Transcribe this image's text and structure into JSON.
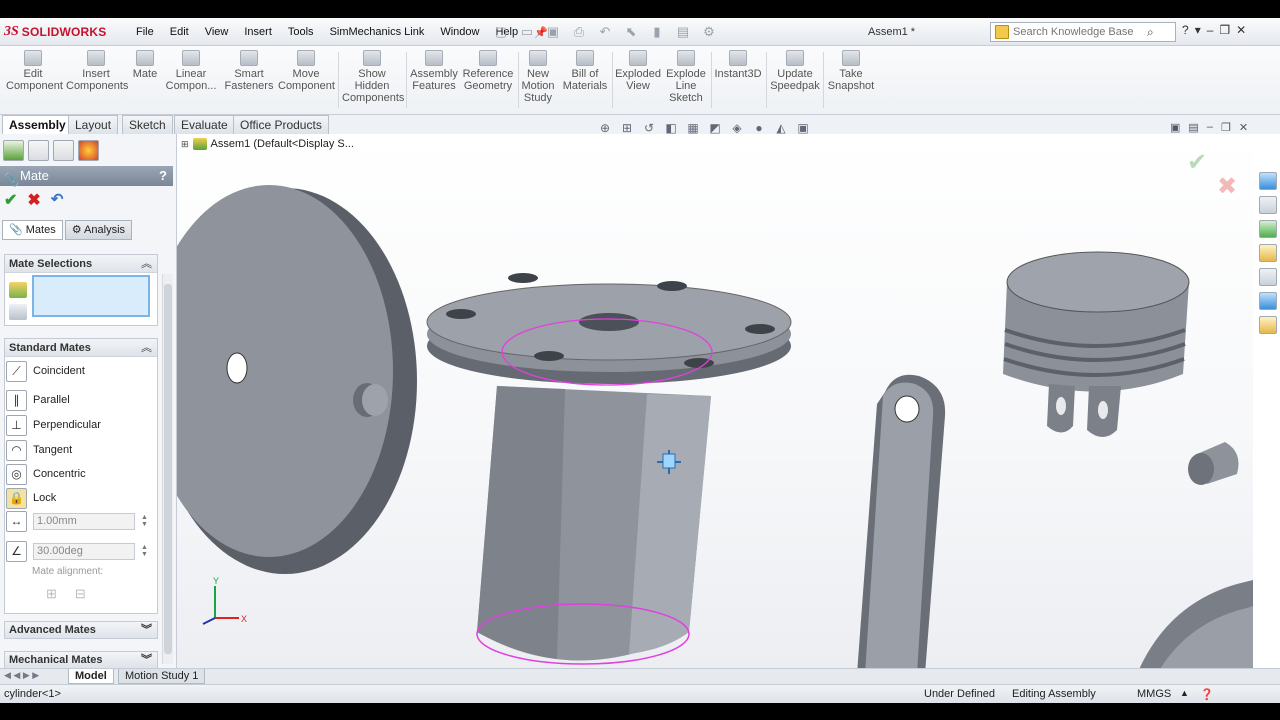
{
  "app": {
    "logo_ds": "3S",
    "logo_text": "SOLIDWORKS",
    "document_title": "Assem1 *"
  },
  "menu": [
    "File",
    "Edit",
    "View",
    "Insert",
    "Tools",
    "SimMechanics Link",
    "Window",
    "Help"
  ],
  "search": {
    "placeholder": "Search Knowledge Base"
  },
  "command_manager": [
    {
      "label_1": "Edit",
      "label_2": "Component",
      "label_3": ""
    },
    {
      "label_1": "Insert",
      "label_2": "Components",
      "label_3": ""
    },
    {
      "label_1": "Mate",
      "label_2": "",
      "label_3": ""
    },
    {
      "label_1": "Linear",
      "label_2": "Compon...",
      "label_3": ""
    },
    {
      "label_1": "Smart",
      "label_2": "Fasteners",
      "label_3": ""
    },
    {
      "label_1": "Move",
      "label_2": "Component",
      "label_3": ""
    },
    {
      "label_1": "Show",
      "label_2": "Hidden",
      "label_3": "Components"
    },
    {
      "label_1": "Assembly",
      "label_2": "Features",
      "label_3": ""
    },
    {
      "label_1": "Reference",
      "label_2": "Geometry",
      "label_3": ""
    },
    {
      "label_1": "New",
      "label_2": "Motion",
      "label_3": "Study"
    },
    {
      "label_1": "Bill of",
      "label_2": "Materials",
      "label_3": ""
    },
    {
      "label_1": "Exploded",
      "label_2": "View",
      "label_3": ""
    },
    {
      "label_1": "Explode",
      "label_2": "Line",
      "label_3": "Sketch"
    },
    {
      "label_1": "Instant3D",
      "label_2": "",
      "label_3": ""
    },
    {
      "label_1": "Update",
      "label_2": "Speedpak",
      "label_3": ""
    },
    {
      "label_1": "Take",
      "label_2": "Snapshot",
      "label_3": ""
    }
  ],
  "tabs": [
    "Assembly",
    "Layout",
    "Sketch",
    "Evaluate",
    "Office Products"
  ],
  "property_manager": {
    "title": "Mate",
    "help": "?",
    "sub_tabs": [
      "Mates",
      "Analysis"
    ],
    "mate_selections_title": "Mate Selections",
    "standard_mates_title": "Standard Mates",
    "standard_mates": [
      "Coincident",
      "Parallel",
      "Perpendicular",
      "Tangent",
      "Concentric",
      "Lock"
    ],
    "distance_value": "1.00mm",
    "angle_value": "30.00deg",
    "mate_alignment_label": "Mate alignment:",
    "advanced_mates_title": "Advanced Mates",
    "mechanical_mates_title": "Mechanical Mates"
  },
  "viewport": {
    "tree_flyout": "Assem1  (Default<Display S...",
    "triad": {
      "x": "X",
      "y": "Y"
    }
  },
  "model_tabs": [
    "Model",
    "Motion Study 1"
  ],
  "status": {
    "left": "cylinder<1>",
    "state": "Under Defined",
    "mode": "Editing Assembly",
    "units": "MMGS"
  },
  "colors": {
    "part_face": "#9a9ea6",
    "part_dark": "#5f636b",
    "selection_edge": "#e040e0",
    "accent_red": "#c8102e"
  }
}
